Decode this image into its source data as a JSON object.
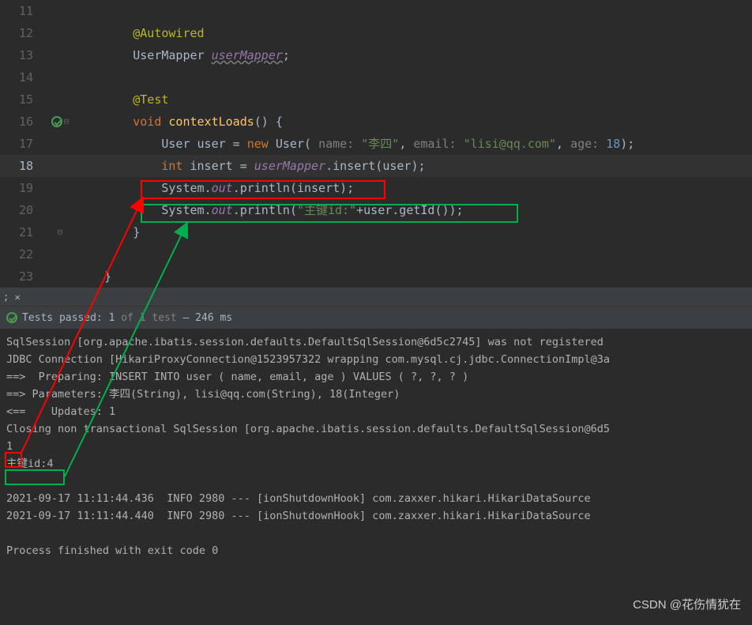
{
  "editor": {
    "lines": {
      "l11": "11",
      "l12": "12",
      "l13": "13",
      "l14": "14",
      "l15": "15",
      "l16": "16",
      "l17": "17",
      "l18": "18",
      "l19": "19",
      "l20": "20",
      "l21": "21",
      "l22": "22",
      "l23": "23"
    },
    "code": {
      "autowired": "@Autowired",
      "usermapper_type": "UserMapper ",
      "usermapper_field": "userMapper",
      "semicolon": ";",
      "test": "@Test",
      "void": "void",
      "method_name": " contextLoads",
      "method_sig": "() {",
      "user_type": "User ",
      "user_var": "user = ",
      "new_kw": "new",
      "user_ctor": " User( ",
      "p_name": "name: ",
      "v_name": "\"李四\"",
      "comma": ", ",
      "p_email": "email: ",
      "v_email": "\"lisi@qq.com\"",
      "p_age": "age: ",
      "v_age": "18",
      "close_paren": ");",
      "int_kw": "int",
      "insert_var": " insert = ",
      "usermapper_ref": "userMapper",
      "dot": ".",
      "insert_call": "insert(user);",
      "system": "System",
      "out": "out",
      "println": "println",
      "insert_arg": "(insert);",
      "primary_key_str": "\"主键id:\"",
      "plus": "+",
      "getid": "user.getId());",
      "close1": "}",
      "close2": "}"
    }
  },
  "status": {
    "tests_passed": "Tests passed: 1",
    "of": " of 1 test",
    "dash": " – 246 ms"
  },
  "console": {
    "l1": "SqlSession [org.apache.ibatis.session.defaults.DefaultSqlSession@6d5c2745] was not registered ",
    "l2": "JDBC Connection [HikariProxyConnection@1523957322 wrapping com.mysql.cj.jdbc.ConnectionImpl@3a",
    "l3": "==>  Preparing: INSERT INTO user ( name, email, age ) VALUES ( ?, ?, ? )",
    "l4": "==> Parameters: 李四(String), lisi@qq.com(String), 18(Integer)",
    "l5": "<==    Updates: 1",
    "l6": "Closing non transactional SqlSession [org.apache.ibatis.session.defaults.DefaultSqlSession@6d5",
    "l7": "1",
    "l8": "主键id:4",
    "l9": " ",
    "l10": "2021-09-17 11:11:44.436  INFO 2980 --- [ionShutdownHook] com.zaxxer.hikari.HikariDataSource   ",
    "l11": "2021-09-17 11:11:44.440  INFO 2980 --- [ionShutdownHook] com.zaxxer.hikari.HikariDataSource   ",
    "l12": " ",
    "l13": "Process finished with exit code 0"
  },
  "watermark": "CSDN @花伤情犹在"
}
